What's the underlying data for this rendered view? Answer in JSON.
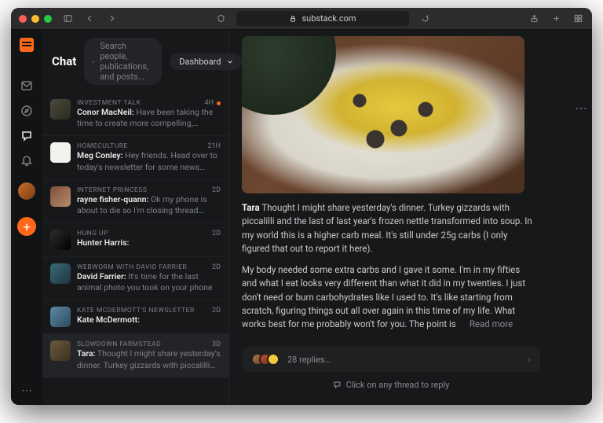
{
  "browser": {
    "url": "substack.com"
  },
  "header": {
    "title": "Chat",
    "search_placeholder": "Search people, publications, and posts...",
    "dashboard_label": "Dashboard"
  },
  "threads": [
    {
      "publication": "INVESTMENT TALK",
      "time": "4H",
      "unread": true,
      "author": "Conor MacNeil:",
      "preview": " Have been taking the time to create more compelling, aesthetically…"
    },
    {
      "publication": "HOMECULTURE",
      "time": "21H",
      "unread": false,
      "author": "Meg Conley:",
      "preview": " Hey friends. Head over to today's newsletter for some news and…"
    },
    {
      "publication": "INTERNET PRINCESS",
      "time": "2D",
      "unread": false,
      "author": "rayne fisher-quann:",
      "preview": " Ok my phone is about to die so I'm closing thread privileges for…"
    },
    {
      "publication": "HUNG UP",
      "time": "2D",
      "unread": false,
      "author": "Hunter Harris:",
      "preview": ""
    },
    {
      "publication": "WEBWORM WITH DAVID FARRIER",
      "time": "2D",
      "unread": false,
      "author": "David Farrier:",
      "preview": " It's time for the last animal photo you took on your phone"
    },
    {
      "publication": "KATE MCDERMOTT'S NEWSLETTER",
      "time": "2D",
      "unread": false,
      "author": "Kate McDermott:",
      "preview": ""
    },
    {
      "publication": "SLOWDOWN FARMSTEAD",
      "time": "3D",
      "unread": false,
      "author": "Tara:",
      "preview": " Thought I might share yesterday's dinner. Turkey gizzards with piccalilli and…",
      "selected": true
    }
  ],
  "post": {
    "author": "Tara",
    "para1": "  Thought I might share yesterday's dinner. Turkey gizzards with piccalilli and the last of last year's frozen nettle transformed into soup. In my world this is a higher carb meal. It's still under 25g carbs (I only figured that out to report it here).",
    "para2_a": "My body needed some extra carbs and I gave it some. I'm in my fifties and what I eat looks very different than what it did in my twenties. I just don't need or burn carbohydrates like I used to. It's like starting from scratch, figuring things out all over again in this time of my life. What works best for me probably won't for you. The point is ",
    "read_more": "Read more",
    "replies_label": "28 replies…"
  },
  "hint": "Click on any thread to reply"
}
